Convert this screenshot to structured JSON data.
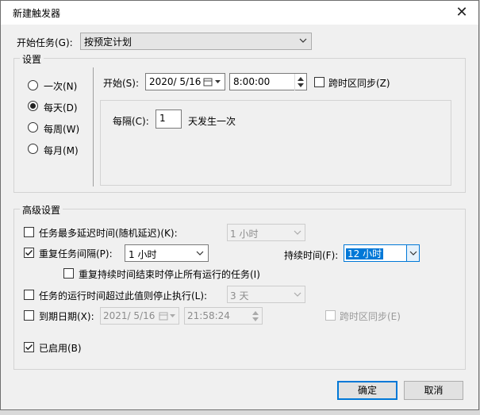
{
  "window": {
    "title": "新建触发器",
    "close_glyph": "✕"
  },
  "begin_task": {
    "label": "开始任务(G):",
    "value": "按预定计划"
  },
  "settings": {
    "label": "设置",
    "radios": [
      {
        "label": "一次(N)",
        "selected": false
      },
      {
        "label": "每天(D)",
        "selected": true
      },
      {
        "label": "每周(W)",
        "selected": false
      },
      {
        "label": "每月(M)",
        "selected": false
      }
    ],
    "start_label": "开始(S):",
    "start_date": "2020/  5/16",
    "start_time": "8:00:00",
    "sync_timezone_label": "跨时区同步(Z)",
    "every_label": "每隔(C):",
    "every_value": "1",
    "every_suffix": "天发生一次"
  },
  "advanced": {
    "label": "高级设置",
    "delay": {
      "label": "任务最多延迟时间(随机延迟)(K):",
      "value": "1 小时",
      "checked": false
    },
    "repeat": {
      "label": "重复任务间隔(P):",
      "value": "1 小时",
      "checked": true
    },
    "duration": {
      "label": "持续时间(F):",
      "value": "12 小时"
    },
    "stop_all": {
      "label": "重复持续时间结束时停止所有运行的任务(I)",
      "checked": false
    },
    "stop_if_longer": {
      "label": "任务的运行时间超过此值则停止执行(L):",
      "value": "3 天",
      "checked": false
    },
    "expire": {
      "label": "到期日期(X):",
      "date": "2021/  5/16",
      "time": "21:58:24",
      "sync_label": "跨时区同步(E)",
      "checked": false
    },
    "enabled": {
      "label": "已启用(B)",
      "checked": true
    }
  },
  "buttons": {
    "ok": "确定",
    "cancel": "取消"
  },
  "colors": {
    "accent": "#0078d7",
    "window_bg": "#f0f0f0"
  }
}
